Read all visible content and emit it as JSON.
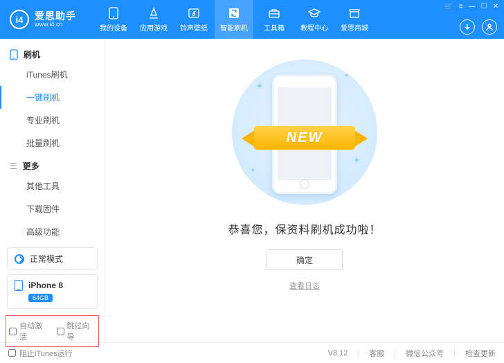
{
  "brand": {
    "mark": "i4",
    "cn": "爱思助手",
    "url": "www.i4.cn"
  },
  "nav": {
    "items": [
      {
        "label": "我的设备"
      },
      {
        "label": "应用游戏"
      },
      {
        "label": "铃声壁纸"
      },
      {
        "label": "智能刷机"
      },
      {
        "label": "工具箱"
      },
      {
        "label": "教程中心"
      },
      {
        "label": "爱思商城"
      }
    ]
  },
  "sidebar": {
    "group1": {
      "title": "刷机",
      "items": [
        "iTunes刷机",
        "一键刷机",
        "专业刷机",
        "批量刷机"
      ]
    },
    "group2": {
      "title": "更多",
      "items": [
        "其他工具",
        "下载固件",
        "高级功能"
      ]
    },
    "mode": "正常模式",
    "device": {
      "name": "iPhone 8",
      "storage": "64GB"
    },
    "opts": {
      "auto": "自动激活",
      "skip": "跳过向导"
    }
  },
  "main": {
    "ribbon": "NEW",
    "message": "恭喜您，保资料刷机成功啦！",
    "ok": "确定",
    "log": "查看日志"
  },
  "footer": {
    "block_itunes": "阻止iTunes运行",
    "version": "V8.12",
    "support": "客服",
    "wechat": "微信公众号",
    "update": "检查更新"
  }
}
